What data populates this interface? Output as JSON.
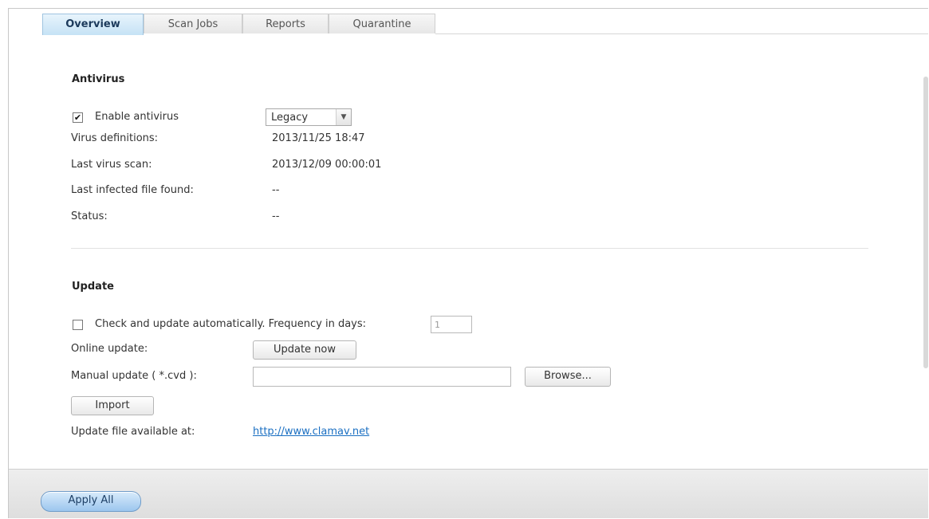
{
  "tabs": [
    {
      "label": "Overview",
      "active": true
    },
    {
      "label": "Scan Jobs",
      "active": false
    },
    {
      "label": "Reports",
      "active": false
    },
    {
      "label": "Quarantine",
      "active": false
    }
  ],
  "antivirus": {
    "title": "Antivirus",
    "enable_label": "Enable antivirus",
    "enable_checked": true,
    "engine_selected": "Legacy",
    "rows": [
      {
        "label": "Virus definitions:",
        "value": "2013/11/25 18:47"
      },
      {
        "label": "Last virus scan:",
        "value": "2013/12/09 00:00:01"
      },
      {
        "label": "Last infected file found:",
        "value": "--"
      },
      {
        "label": "Status:",
        "value": "--"
      }
    ]
  },
  "update": {
    "title": "Update",
    "auto_label": "Check and update automatically. Frequency in days:",
    "auto_checked": false,
    "frequency_value": "1",
    "online_label": "Online update:",
    "update_now_label": "Update now",
    "manual_label": "Manual update ( *.cvd ):",
    "manual_value": "",
    "browse_label": "Browse...",
    "import_label": "Import",
    "available_label": "Update file available at:",
    "available_link": "http://www.clamav.net"
  },
  "footer": {
    "apply_label": "Apply All"
  },
  "colors": {
    "active_tab": "#c5e2f5",
    "link": "#1a6fc2",
    "apply_button": "#9cc6ee"
  }
}
